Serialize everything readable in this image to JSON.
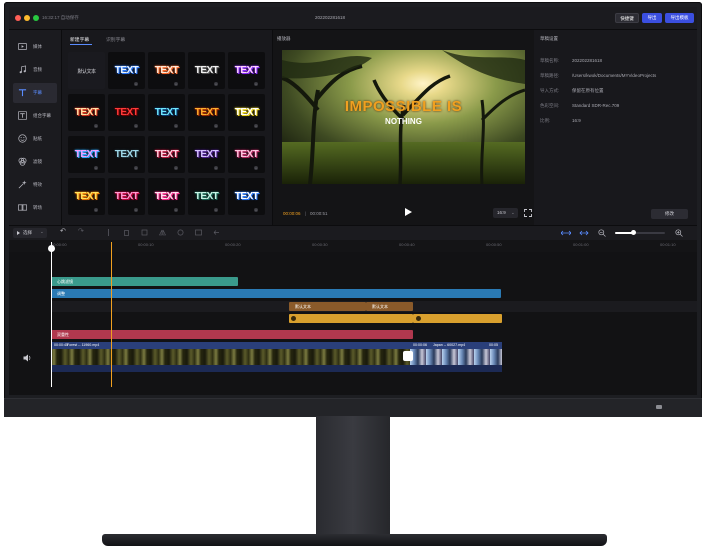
{
  "titlebar": {
    "app_name": "16:32:17 自动保存",
    "project_title": "202202281618",
    "buttons": {
      "shortcut": "快捷键",
      "export": "导出",
      "export_template": "导出模板"
    }
  },
  "sidebar": {
    "items": [
      {
        "label": "媒体",
        "icon": "media-icon",
        "active": false
      },
      {
        "label": "音频",
        "icon": "music-note-icon",
        "active": false
      },
      {
        "label": "字幕",
        "icon": "text-icon",
        "active": true
      },
      {
        "label": "组合字幕",
        "icon": "combo-text-icon",
        "active": false
      },
      {
        "label": "贴纸",
        "icon": "sticker-icon",
        "active": false
      },
      {
        "label": "滤镜",
        "icon": "filter-icon",
        "active": false
      },
      {
        "label": "特效",
        "icon": "effect-icon",
        "active": false
      },
      {
        "label": "转场",
        "icon": "transition-icon",
        "active": false
      }
    ]
  },
  "templates": {
    "tabs": [
      "新建字幕",
      "识别字幕"
    ],
    "default_tile": "默认文本",
    "tiles": [
      {
        "text": "TEXT",
        "color": "#e9f4ff",
        "stroke": "#2b7bff"
      },
      {
        "text": "TEXT",
        "color": "#ffe9d6",
        "stroke": "#ff6a2b"
      },
      {
        "text": "TEXT",
        "color": "#f1f1f1",
        "stroke": "#555555"
      },
      {
        "text": "TEXT",
        "color": "#ffd4ff",
        "stroke": "#8a2bff"
      },
      {
        "text": "TEXT",
        "color": "#ffe3a8",
        "stroke": "#d8321c"
      },
      {
        "text": "TEXT",
        "color": "#ff3a3a",
        "stroke": "#6a0000"
      },
      {
        "text": "TEXT",
        "color": "#6fe8ff",
        "stroke": "#0a3b72"
      },
      {
        "text": "TEXT",
        "color": "#ffb02e",
        "stroke": "#a02a00"
      },
      {
        "text": "TEXT",
        "color": "#ffffff",
        "stroke": "#f2d91b"
      },
      {
        "text": "TEXT",
        "color": "#f3a0ff",
        "stroke": "#2aa8ff"
      },
      {
        "text": "TEXT",
        "color": "#9fd8e8",
        "stroke": "#20323a"
      },
      {
        "text": "TEXT",
        "color": "#ffd2e0",
        "stroke": "#b8143c"
      },
      {
        "text": "TEXT",
        "color": "#d6c3ff",
        "stroke": "#4a1d8c"
      },
      {
        "text": "TEXT",
        "color": "#ffc6e0",
        "stroke": "#b0245c"
      },
      {
        "text": "TEXT",
        "color": "#ffe45e",
        "stroke": "#f07800"
      },
      {
        "text": "TEXT",
        "color": "#ff9ad0",
        "stroke": "#c4003c"
      },
      {
        "text": "TEXT",
        "color": "#ffe0f0",
        "stroke": "#ff2a8c"
      },
      {
        "text": "TEXT",
        "color": "#c8f5e6",
        "stroke": "#1b6a58"
      },
      {
        "text": "TEXT",
        "color": "#ffffff",
        "stroke": "#2a7bff"
      }
    ]
  },
  "player": {
    "header": "播放器",
    "overlay_title": "IMPOSSIBLE IS",
    "overlay_subtitle": "NOTHING",
    "current_time": "00:00:06",
    "total_time": "00:00:51",
    "aspect_ratio": "16:9",
    "accent": "#f0a020"
  },
  "properties": {
    "header": "草稿设置",
    "rows": [
      {
        "key": "草稿名称:",
        "value": "202202281618"
      },
      {
        "key": "草稿路径:",
        "value": "/Users/kwok/Documents/MYVideoProjects"
      },
      {
        "key": "导入方式:",
        "value": "保留在原有位置"
      },
      {
        "key": "色彩空间:",
        "value": "Standard SDR-Rec.709"
      },
      {
        "key": "比例:",
        "value": "16:9"
      }
    ],
    "edit_button": "修改"
  },
  "timeline": {
    "select_tool": "选择",
    "ruler": [
      "00:00:00",
      "00:00:10",
      "00:00:20",
      "00:00:30",
      "00:00:40",
      "00:00:50",
      "00:01:00",
      "00:01:10"
    ],
    "tracks": {
      "clip_a": "心跳滤镜",
      "clip_b": "调整",
      "text_1": "默认文本",
      "text_2": "默认文本",
      "sticker_clip": "双重性",
      "video_1_time": "00:00:45",
      "video_1_name": "Forest -- 11960.mp4",
      "video_2_time": "00:00:06",
      "video_2_name": "Japan -- 60027.mp4",
      "video_3_time": "00:05"
    },
    "colors": {
      "teal": "#3a9a8c",
      "blue": "#2a7ab5",
      "orange": "#c87a2a",
      "yellow": "#d9a02e",
      "red": "#b0384e",
      "video_bar": "#2a3f7a"
    }
  }
}
